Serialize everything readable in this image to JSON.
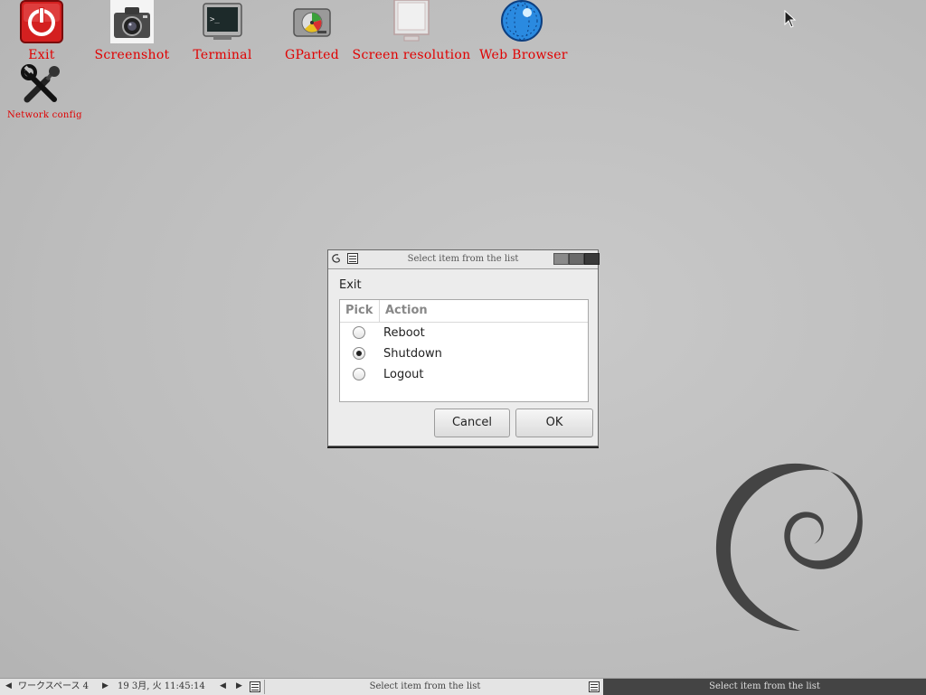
{
  "desktop_icons": [
    {
      "label": "Exit",
      "icon": "power-icon"
    },
    {
      "label": "Screenshot",
      "icon": "camera-icon"
    },
    {
      "label": "Terminal",
      "icon": "terminal-icon"
    },
    {
      "label": "GParted",
      "icon": "disk-icon"
    },
    {
      "label": "Screen resolution",
      "icon": "monitor-icon"
    },
    {
      "label": "Web Browser",
      "icon": "globe-icon"
    },
    {
      "label": "Network config",
      "icon": "tools-icon"
    }
  ],
  "dialog": {
    "title": "Select item from the list",
    "heading": "Exit",
    "columns": [
      "Pick",
      "Action"
    ],
    "options": [
      {
        "label": "Reboot",
        "selected": false
      },
      {
        "label": "Shutdown",
        "selected": true
      },
      {
        "label": "Logout",
        "selected": false
      }
    ],
    "cancel_label": "Cancel",
    "ok_label": "OK"
  },
  "taskbar": {
    "workspace": "ワークスペース 4",
    "clock": "19 3月, 火 11:45:14",
    "task_inactive": "Select item from the list",
    "task_active": "Select item from the list"
  },
  "colors": {
    "icon_label": "#e00000",
    "desktop": "#bdbdbd",
    "active_task": "#444444"
  }
}
